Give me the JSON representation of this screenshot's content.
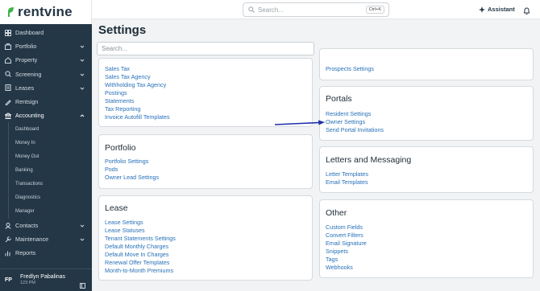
{
  "app": {
    "logo_text": "rentvine"
  },
  "sidebar": {
    "items": [
      {
        "label": "Dashboard",
        "icon": "dashboard-icon"
      },
      {
        "label": "Portfolio",
        "icon": "portfolio-icon",
        "has_chevron": true
      },
      {
        "label": "Property",
        "icon": "property-icon",
        "has_chevron": true
      },
      {
        "label": "Screening",
        "icon": "screening-icon",
        "has_chevron": true
      },
      {
        "label": "Leases",
        "icon": "leases-icon",
        "has_chevron": true
      },
      {
        "label": "Rentsign",
        "icon": "rentsign-icon"
      },
      {
        "label": "Accounting",
        "icon": "accounting-icon",
        "has_chevron": true,
        "expanded": true
      }
    ],
    "accounting_sub": [
      "Dashboard",
      "Money In",
      "Money Out",
      "Banking",
      "Transactions",
      "Diagnostics",
      "Manager"
    ],
    "items_after": [
      {
        "label": "Contacts",
        "icon": "contacts-icon",
        "has_chevron": true
      },
      {
        "label": "Maintenance",
        "icon": "maintenance-icon",
        "has_chevron": true
      },
      {
        "label": "Reports",
        "icon": "reports-icon"
      }
    ],
    "user": {
      "initials": "FP",
      "name": "Fredlyn Pabalinas",
      "sub": "123 PM"
    }
  },
  "topbar": {
    "search_placeholder": "Search...",
    "shortcut": "Ctrl+K",
    "assistant_label": "Assistant"
  },
  "main": {
    "title": "Settings",
    "search_placeholder": "Search...",
    "cards_left": [
      {
        "title": "",
        "links": [
          "Sales Tax",
          "Sales Tax Agency",
          "Withholding Tax Agency",
          "Postings",
          "Statements",
          "Tax Reporting",
          "Invoice Autofill Templates"
        ]
      },
      {
        "title": "Portfolio",
        "links": [
          "Portfolio Settings",
          "Pods",
          "Owner Lead Settings"
        ]
      },
      {
        "title": "Lease",
        "links": [
          "Lease Settings",
          "Lease Statuses",
          "Tenant Statements Settings",
          "Default Monthly Charges",
          "Default Move In Charges",
          "Renewal Offer Templates",
          "Month-to-Month Premiums"
        ]
      }
    ],
    "cards_right": [
      {
        "title": "",
        "links": [
          "Prospects Settings"
        ]
      },
      {
        "title": "Portals",
        "links": [
          "Resident Settings",
          "Owner Settings",
          "Send Portal Invitations"
        ]
      },
      {
        "title": "Letters and Messaging",
        "links": [
          "Letter Templates",
          "Email Templates"
        ]
      },
      {
        "title": "Other",
        "links": [
          "Custom Fields",
          "Convert Filters",
          "Email Signature",
          "Snippets",
          "Tags",
          "Webhooks"
        ]
      }
    ]
  },
  "colors": {
    "sidebar_bg": "#243746",
    "link": "#2770b8",
    "accent_green": "#3bb54a",
    "arrow": "#1a2fa8"
  }
}
